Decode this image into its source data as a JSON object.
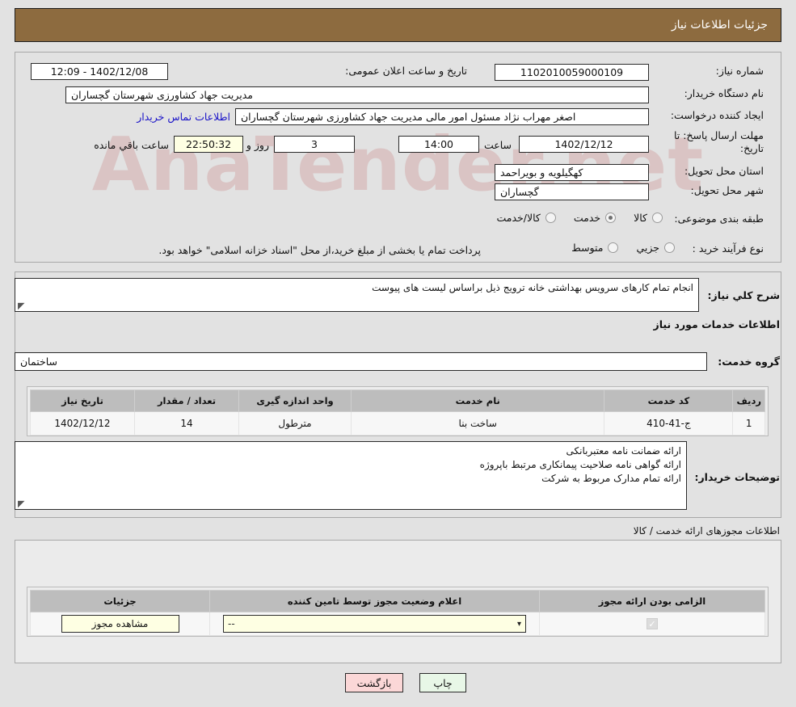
{
  "header": {
    "title": "جزئیات اطلاعات نیاز",
    "accent_color": "#8d6b3f"
  },
  "watermark": {
    "text": "AnaTender.net"
  },
  "form": {
    "need_number": {
      "label": "شماره نیاز:",
      "value": "1102010059000109"
    },
    "public_announce": {
      "label": "تاریخ و ساعت اعلان عمومی:",
      "value": "1402/12/08 - 12:09"
    },
    "buyer_org": {
      "label": "نام دستگاه خریدار:",
      "value": "مدیریت جهاد کشاورزی شهرستان گچساران"
    },
    "request_creator": {
      "label": "ایجاد کننده درخواست:",
      "value": "اصغر مهراب نژاد مسئول امور مالی مدیریت جهاد کشاورزی شهرستان گچساران"
    },
    "buyer_contact_link": "اطلاعات تماس خریدار",
    "deadline": {
      "label": "مهلت ارسال پاسخ: تا تاریخ:",
      "date": "1402/12/12",
      "time_label": "ساعت",
      "time": "14:00",
      "days": "3",
      "days_label": "روز و",
      "countdown": "22:50:32",
      "countdown_label": "ساعت باقي مانده"
    },
    "province": {
      "label": "استان محل تحویل:",
      "value": "کهگیلویه و بویراحمد"
    },
    "city": {
      "label": "شهر محل تحویل:",
      "value": "گچساران"
    },
    "category": {
      "label": "طبقه بندی موضوعی:",
      "options": [
        "کالا",
        "خدمت",
        "کالا/خدمت"
      ],
      "selected": "خدمت"
    },
    "purchase_process": {
      "label": "نوع فرآیند خرید :",
      "options": [
        "جزیي",
        "متوسط"
      ],
      "selected": "",
      "note": "پرداخت تمام یا بخشی از مبلغ خرید،از محل \"اسناد خزانه اسلامی\" خواهد بود."
    }
  },
  "general_need": {
    "label": "شرح کلي نیاز:",
    "value": "انجام تمام کارهای سرویس بهداشتی خانه ترویج ذیل براساس لیست های پیوست"
  },
  "services_section": {
    "title": "اطلاعات خدمات مورد نیاز",
    "service_group": {
      "label": "گروه خدمت:",
      "value": "ساختمان"
    },
    "table": {
      "columns": [
        "ردیف",
        "کد خدمت",
        "نام خدمت",
        "واحد اندازه گیری",
        "تعداد / مقدار",
        "تاریخ نیاز"
      ],
      "rows": [
        [
          "1",
          "ج-41-410",
          "ساخت بنا",
          "مترطول",
          "14",
          "1402/12/12"
        ]
      ]
    }
  },
  "buyer_notes": {
    "label": "توضیحات خریدار:",
    "lines": [
      "ارائه ضمانت نامه معتبربانکی",
      "ارائه گواهی نامه صلاحیت پیمانکاری مرتبط باپروژه",
      "ارائه تمام مدارک مربوط به شرکت"
    ]
  },
  "permits_section": {
    "title": "اطلاعات مجوزهای ارائه خدمت / کالا",
    "table": {
      "columns": [
        "الزامی بودن ارائه مجوز",
        "اعلام وضعیت مجوز توسط تامین کننده",
        "جزئیات"
      ],
      "rows": [
        {
          "required": true,
          "status": "--",
          "details_button": "مشاهده مجوز"
        }
      ]
    }
  },
  "footer": {
    "print_button": "چاپ",
    "back_button": "بازگشت"
  }
}
